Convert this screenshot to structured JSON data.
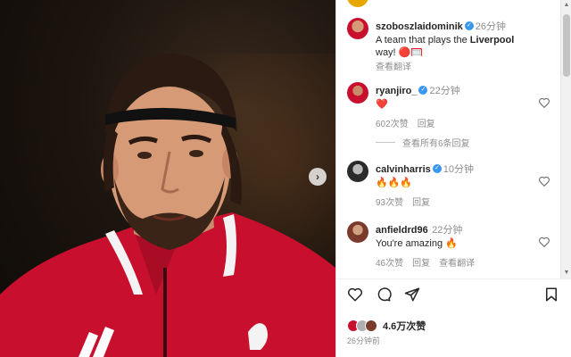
{
  "post": {
    "author": "szoboszlaidominik",
    "time": "26分钟",
    "caption_prefix": "A team that plays the ",
    "caption_bold": "Liverpool",
    "caption_suffix": "way! 🔴🥅",
    "see_translation": "查看翻译"
  },
  "comments": [
    {
      "username": "ryanjiro_",
      "verified": true,
      "time": "22分钟",
      "text": "❤️",
      "likes": "602次赞",
      "reply": "回复",
      "translate": ""
    },
    {
      "username": "calvinharris",
      "verified": true,
      "time": "10分钟",
      "text": "🔥🔥🔥",
      "likes": "93次赞",
      "reply": "回复",
      "translate": ""
    },
    {
      "username": "anfieldrd96",
      "verified": false,
      "time": "22分钟",
      "text": "You're amazing 🔥",
      "likes": "46次赞",
      "reply": "回复",
      "translate": "查看翻译"
    }
  ],
  "view_replies": "查看所有6条回复",
  "footer": {
    "likes": "4.6万次赞",
    "post_time": "26分钟前"
  },
  "icons": {
    "like": "heart-outline-icon",
    "comment": "comment-bubble-icon",
    "share": "paper-plane-icon",
    "save": "bookmark-icon",
    "next": "chevron-right-icon"
  },
  "colors": {
    "accent": "#3897f0",
    "jacket": "#c8102e",
    "text": "#262626",
    "muted": "#8e8e8e",
    "heart": "#ed4956"
  }
}
